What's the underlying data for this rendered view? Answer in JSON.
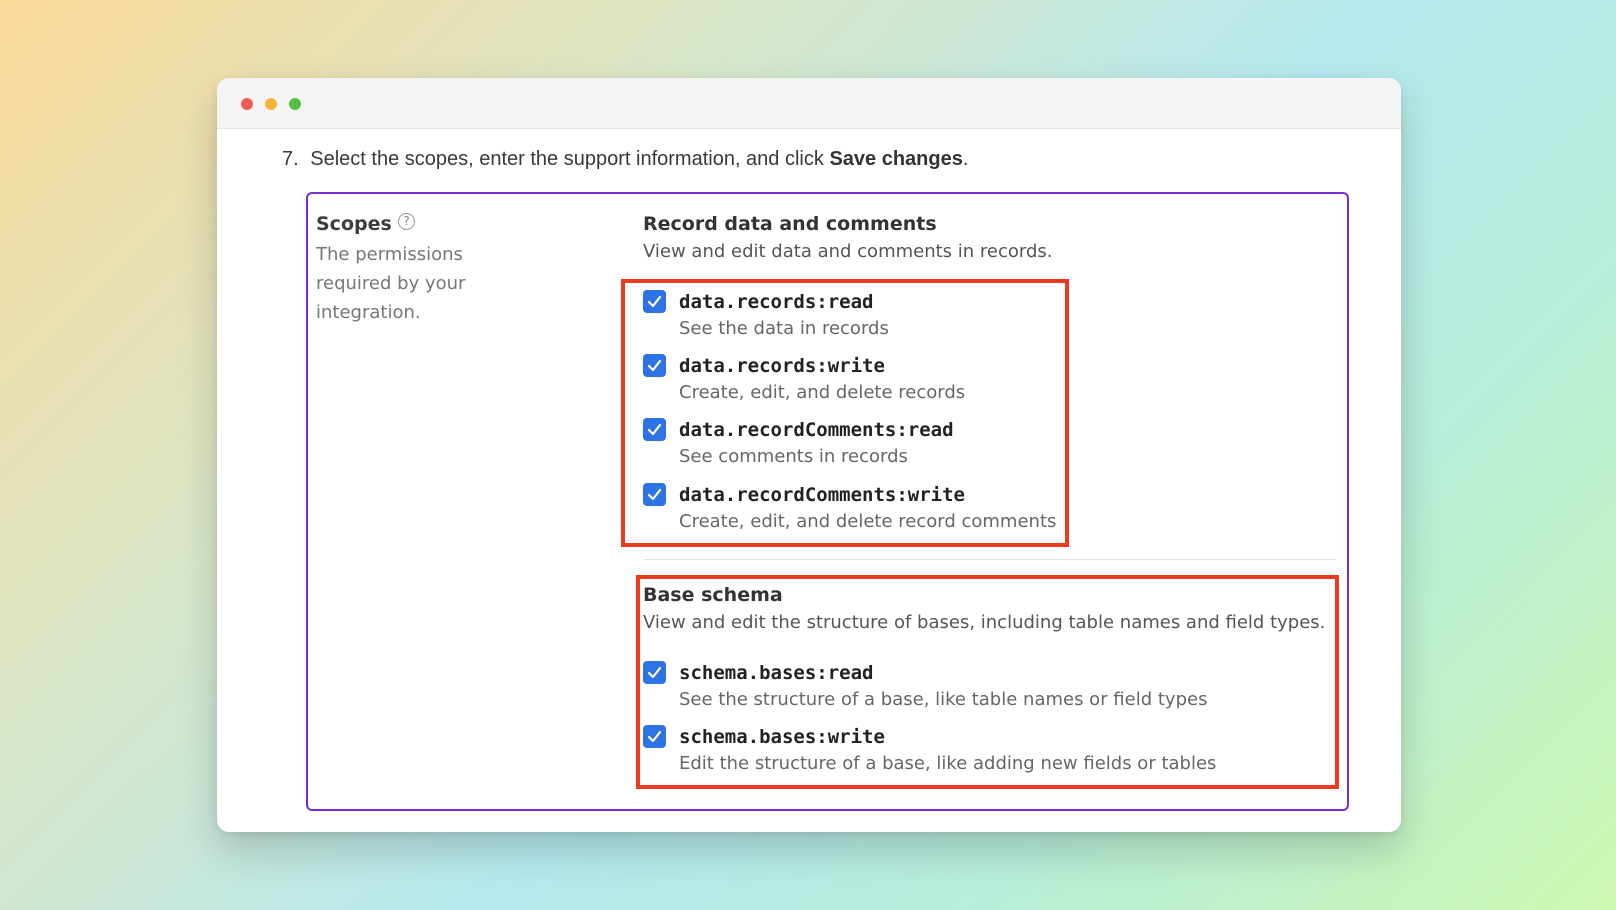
{
  "window": {
    "controls": [
      "close",
      "minimize",
      "zoom"
    ]
  },
  "step": {
    "number": "7.",
    "text": "Select the scopes, enter the support information, and click",
    "action": "Save changes",
    "end": "."
  },
  "scopes": {
    "title": "Scopes",
    "help_icon": "?",
    "description": "The permissions required by your integration."
  },
  "groups": [
    {
      "title": "Record data and comments",
      "description": "View and edit data and comments in records.",
      "items": [
        {
          "name": "data.records:read",
          "description": "See the data in records",
          "checked": true
        },
        {
          "name": "data.records:write",
          "description": "Create, edit, and delete records",
          "checked": true
        },
        {
          "name": "data.recordComments:read",
          "description": "See comments in records",
          "checked": true
        },
        {
          "name": "data.recordComments:write",
          "description": "Create, edit, and delete record comments",
          "checked": true
        }
      ]
    },
    {
      "title": "Base schema",
      "description": "View and edit the structure of bases, including table names and field types.",
      "items": [
        {
          "name": "schema.bases:read",
          "description": "See the structure of a base, like table names or field types",
          "checked": true
        },
        {
          "name": "schema.bases:write",
          "description": "Edit the structure of a base, like adding new fields or tables",
          "checked": true
        }
      ]
    }
  ],
  "colors": {
    "checkbox": "#2d73e3",
    "highlight": "#ef3a22",
    "panel_border": "#7b2bd6"
  }
}
